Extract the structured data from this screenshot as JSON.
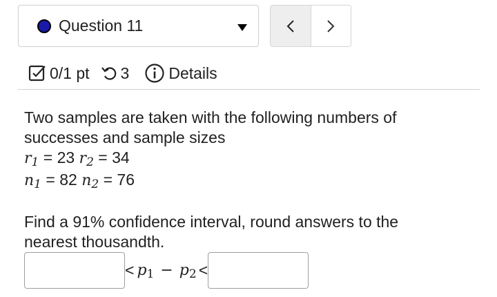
{
  "header": {
    "question_label": "Question 11",
    "status_color": "#1a1aa8"
  },
  "nav": {
    "prev_symbol": "‹",
    "next_symbol": "›"
  },
  "meta": {
    "score": "0/1 pt",
    "attempts": "3",
    "details_label": "Details"
  },
  "question": {
    "intro_line1": "Two samples are taken with the following numbers of",
    "intro_line2": "successes and sample sizes",
    "r1_value": "= 23",
    "r2_value": "= 34",
    "n1_value": "= 82",
    "n2_value": "= 76",
    "prompt_line1": "Find a 91% confidence interval, round answers to the",
    "prompt_line2": "nearest thousandth."
  },
  "answer": {
    "lower_value": "",
    "upper_value": "",
    "less_than": "<",
    "expr_p": "p",
    "sub1": "1",
    "sub2": "2",
    "minus": "−"
  }
}
